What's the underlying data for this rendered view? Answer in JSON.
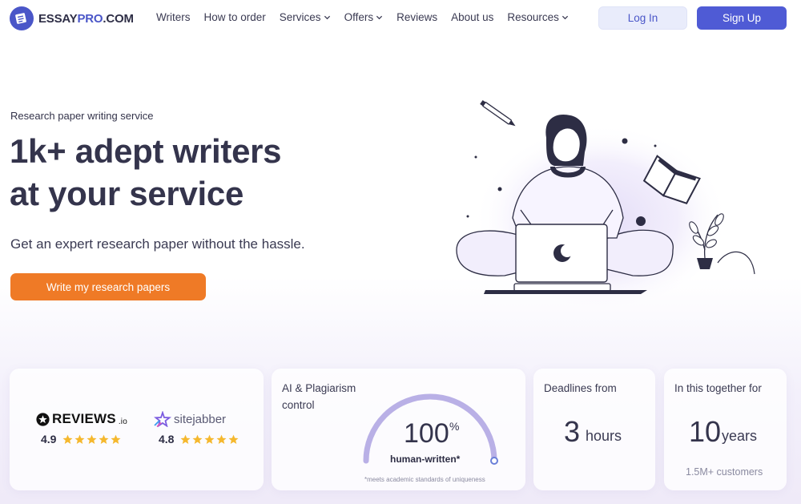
{
  "header": {
    "logo": {
      "part1": "ESSAY",
      "part2": "PRO",
      "part3": ".COM"
    },
    "nav": [
      {
        "label": "Writers",
        "dropdown": false
      },
      {
        "label": "How to order",
        "dropdown": false
      },
      {
        "label": "Services",
        "dropdown": true
      },
      {
        "label": "Offers",
        "dropdown": true
      },
      {
        "label": "Reviews",
        "dropdown": false
      },
      {
        "label": "About us",
        "dropdown": false
      },
      {
        "label": "Resources",
        "dropdown": true
      }
    ],
    "login_label": "Log In",
    "signup_label": "Sign Up"
  },
  "hero": {
    "kicker": "Research paper writing service",
    "title_line1": "1k+ adept writers",
    "title_line2": "at your service",
    "subtitle": "Get an expert research paper without the hassle.",
    "cta_label": "Write my research papers"
  },
  "cards": {
    "reviews": [
      {
        "brand": "REVIEWS",
        "suffix": ".io",
        "score": "4.9",
        "stars": 5
      },
      {
        "brand": "sitejabber",
        "score": "4.8",
        "stars": 5
      }
    ],
    "ai": {
      "label_line1": "AI & Plagiarism",
      "label_line2": "control",
      "value": "100",
      "value_unit": "%",
      "caption": "human-written*",
      "fine_print": "*meets academic standards of uniqueness",
      "gauge_level": 1.0
    },
    "deadline": {
      "label": "Deadlines from",
      "value": "3",
      "unit": "hours"
    },
    "together": {
      "label": "In this together for",
      "value": "10",
      "unit": "years",
      "sub": "1.5M+ customers"
    }
  },
  "colors": {
    "brand": "#4f5bd5",
    "cta": "#ef7a26",
    "star": "#f5b82e",
    "gauge_track": "#e6e0f4",
    "gauge_fill": "#b9b0e6"
  }
}
